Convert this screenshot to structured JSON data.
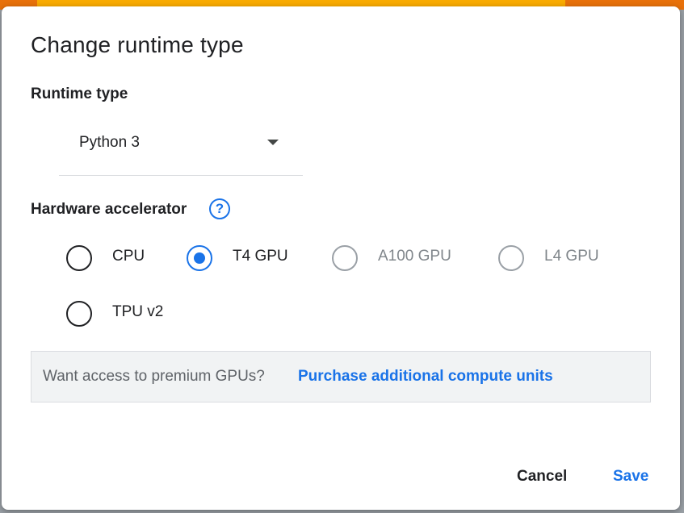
{
  "dialog": {
    "title": "Change runtime type",
    "runtime_type_label": "Runtime type",
    "runtime_select": {
      "value": "Python 3"
    },
    "hardware_label": "Hardware accelerator",
    "help_icon": "help-circle-icon",
    "accelerators": [
      {
        "label": "CPU",
        "selected": false,
        "disabled": false
      },
      {
        "label": "T4 GPU",
        "selected": true,
        "disabled": false
      },
      {
        "label": "A100 GPU",
        "selected": false,
        "disabled": true
      },
      {
        "label": "L4 GPU",
        "selected": false,
        "disabled": true
      },
      {
        "label": "TPU v2",
        "selected": false,
        "disabled": false
      }
    ],
    "info": {
      "text": "Want access to premium GPUs?",
      "link": "Purchase additional compute units"
    },
    "buttons": {
      "cancel": "Cancel",
      "save": "Save"
    }
  },
  "colors": {
    "accent": "#1a73e8",
    "text": "#202124",
    "disabled": "#80868b",
    "info_bg": "#f1f3f4",
    "top_strip_orange": "#e8710a",
    "top_strip_yellow": "#f9ab00"
  }
}
